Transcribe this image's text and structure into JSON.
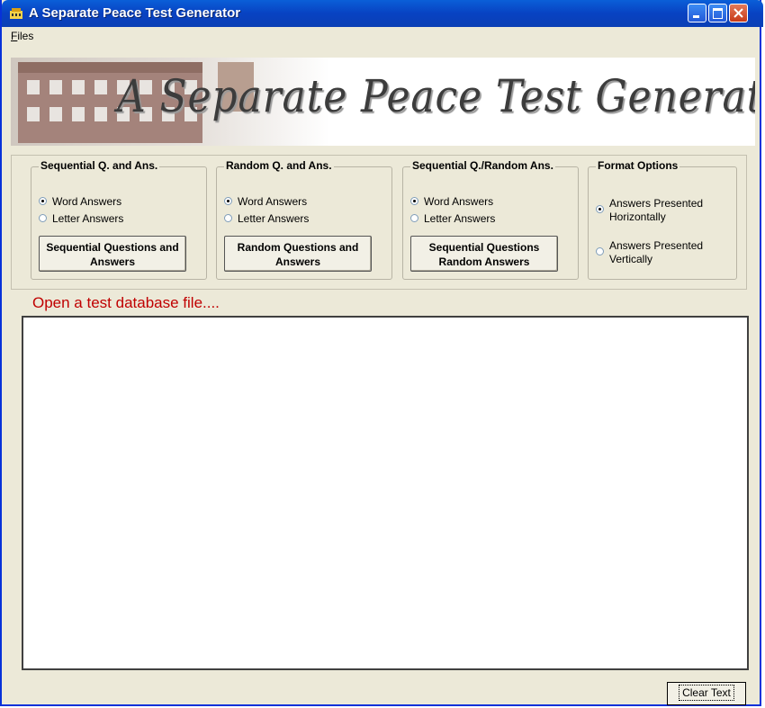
{
  "window": {
    "title": "A Separate Peace Test Generator"
  },
  "menu": {
    "files_mnemonic": "F",
    "files_rest": "iles"
  },
  "banner": {
    "title": "A Separate Peace Test Generator"
  },
  "groups": [
    {
      "title": "Sequential Q. and Ans.",
      "word": "Word Answers",
      "letter": "Letter Answers",
      "button": "Sequential Questions and Answers"
    },
    {
      "title": "Random Q. and Ans.",
      "word": "Word Answers",
      "letter": "Letter Answers",
      "button": "Random Questions and Answers"
    },
    {
      "title": "Sequential Q./Random Ans.",
      "word": "Word Answers",
      "letter": "Letter Answers",
      "button": "Sequential Questions Random Answers"
    }
  ],
  "format": {
    "title": "Format Options",
    "horizontal": "Answers Presented Horizontally",
    "vertical": "Answers Presented Vertically"
  },
  "status_text": "Open a test database file....",
  "output_text": "",
  "clear_button": "Clear Text"
}
